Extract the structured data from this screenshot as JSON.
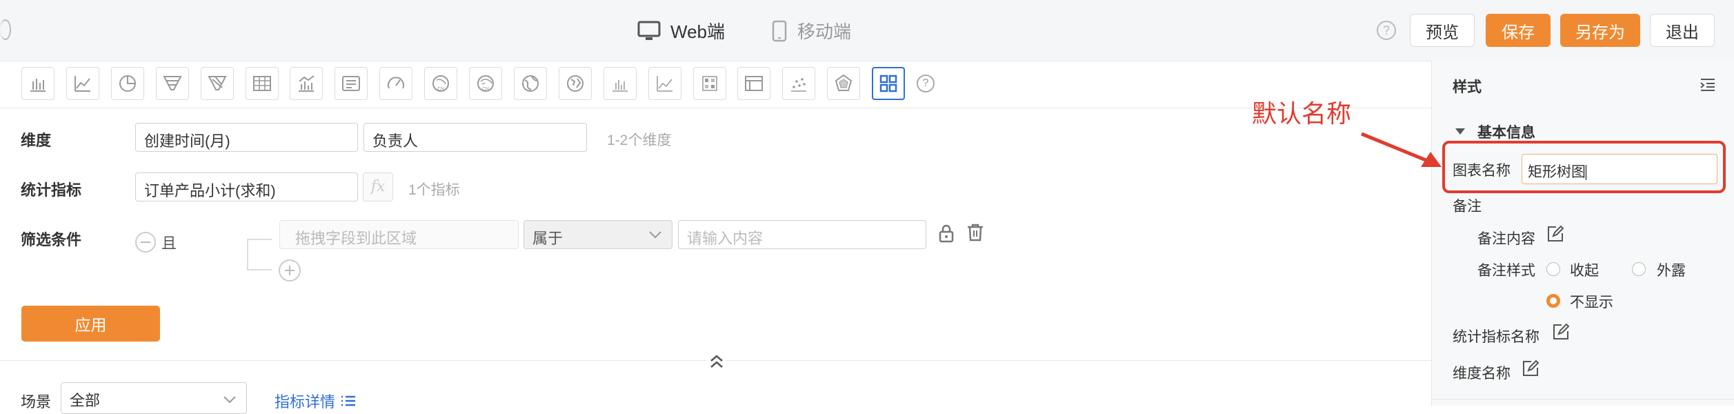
{
  "header": {
    "modes": [
      {
        "label": "Web端",
        "icon": "monitor-icon",
        "active": true
      },
      {
        "label": "移动端",
        "icon": "mobile-icon",
        "active": false
      }
    ],
    "buttons": {
      "preview": "预览",
      "save": "保存",
      "save_as": "另存为",
      "exit": "退出"
    }
  },
  "toolbar": {
    "icons": [
      "bar-chart-icon",
      "line-chart-icon",
      "pie-chart-icon",
      "funnel-icon",
      "funnel-alt-icon",
      "table-icon",
      "combo-chart-icon",
      "text-card-icon",
      "gauge-icon",
      "china-map-icon",
      "china-map-alt-icon",
      "world-map-icon",
      "globe-map-icon",
      "column-chart-icon",
      "area-chart-icon",
      "heatmap-icon",
      "pivot-table-icon",
      "scatter-icon",
      "radar-icon",
      "treemap-icon",
      "help-icon"
    ],
    "selected": "treemap-icon"
  },
  "form": {
    "dimension": {
      "label": "维度",
      "values": [
        "创建时间(月)",
        "负责人"
      ],
      "hint": "1-2个维度"
    },
    "metric": {
      "label": "统计指标",
      "value": "订单产品小计(求和)",
      "fx": "fx",
      "hint": "1个指标"
    },
    "filter": {
      "label": "筛选条件",
      "logic": "且",
      "drag_placeholder": "拖拽字段到此区域",
      "operator": "属于",
      "value_placeholder": "请输入内容"
    },
    "apply": "应用"
  },
  "bottom": {
    "scene_label": "场景",
    "scene_value": "全部",
    "metric_detail": "指标详情"
  },
  "panel": {
    "title": "样式",
    "section": "基本信息",
    "chart_name_label": "图表名称",
    "chart_name_value": "矩形树图",
    "note_label": "备注",
    "note_content_label": "备注内容",
    "note_style_label": "备注样式",
    "note_styles": [
      {
        "label": "收起",
        "checked": false
      },
      {
        "label": "外露",
        "checked": false
      },
      {
        "label": "不显示",
        "checked": true
      }
    ],
    "metric_name_label": "统计指标名称",
    "dimension_name_label": "维度名称"
  },
  "annotation": {
    "text": "默认名称",
    "color": "#e03c2f"
  },
  "colors": {
    "accent": "#f08a32",
    "selected_border": "#2f6fd6",
    "link": "#2f6fd6"
  }
}
